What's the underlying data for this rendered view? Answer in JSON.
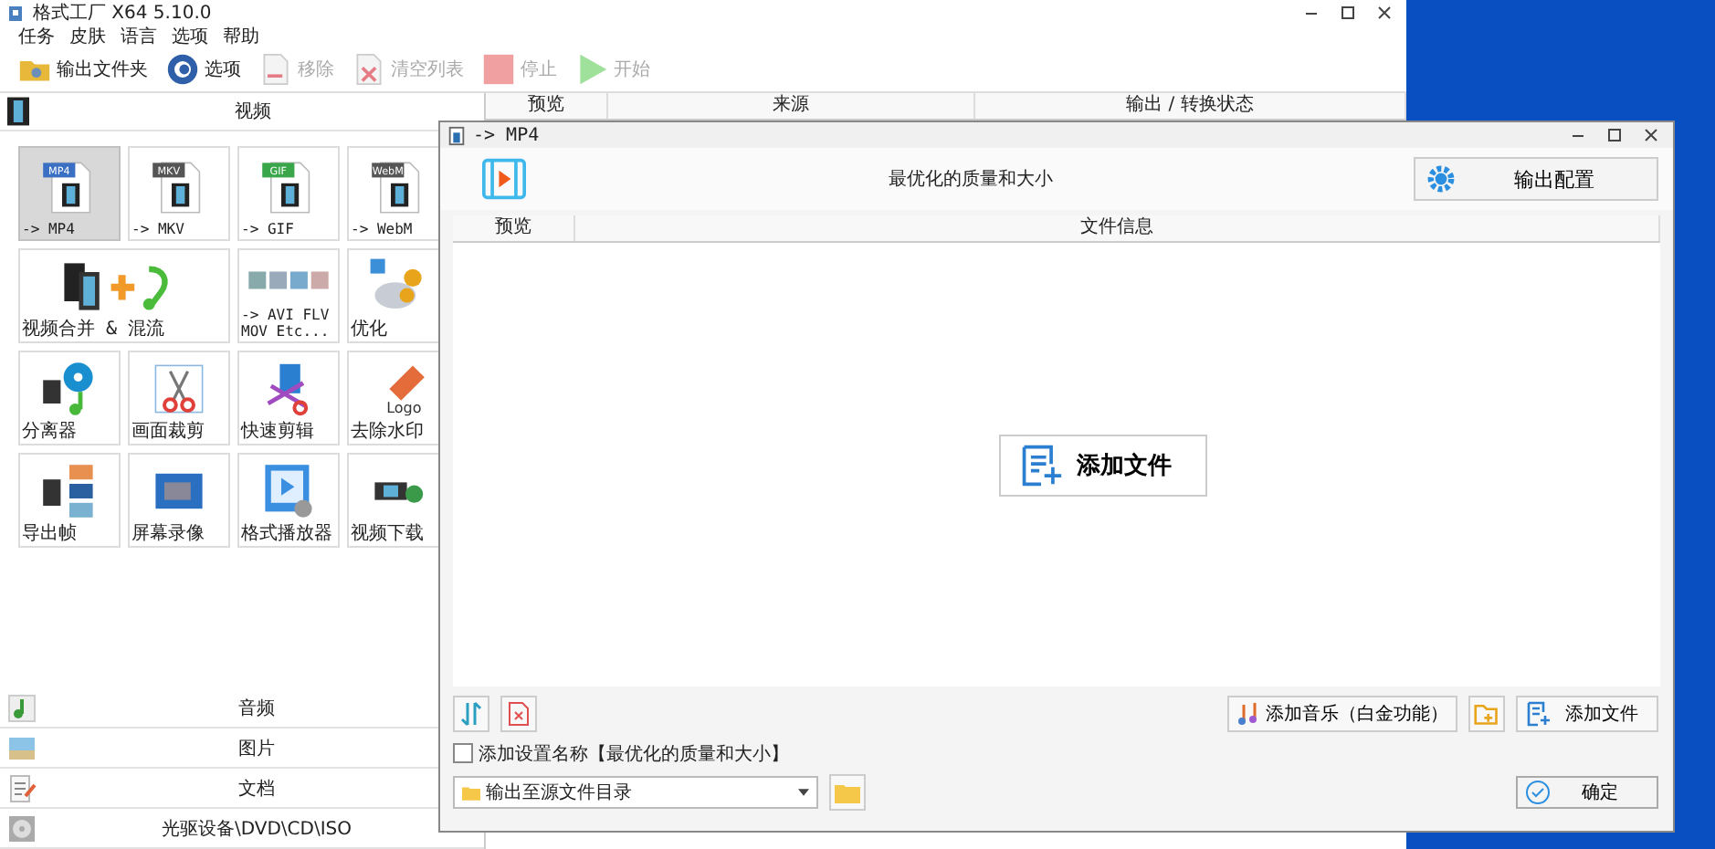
{
  "main_window": {
    "title": "格式工厂 X64 5.10.0",
    "menu": [
      "任务",
      "皮肤",
      "语言",
      "选项",
      "帮助"
    ],
    "toolbar": [
      {
        "label": "输出文件夹",
        "kind": "folder",
        "disabled": false
      },
      {
        "label": "选项",
        "kind": "options",
        "disabled": false
      },
      {
        "label": "移除",
        "kind": "remove",
        "disabled": true
      },
      {
        "label": "清空列表",
        "kind": "clear",
        "disabled": true
      },
      {
        "label": "停止",
        "kind": "stop",
        "disabled": true
      },
      {
        "label": "开始",
        "kind": "start",
        "disabled": true
      }
    ],
    "video_category": {
      "label": "视频"
    },
    "tools": [
      {
        "label": "-> MP4",
        "kind": "format",
        "badge": "MP4",
        "color": "#3a6fc4",
        "selected": true
      },
      {
        "label": "-> MKV",
        "kind": "format",
        "badge": "MKV",
        "color": "#555555",
        "selected": false
      },
      {
        "label": "-> GIF",
        "kind": "format",
        "badge": "GIF",
        "color": "#3aa64a",
        "selected": false
      },
      {
        "label": "-> WebM",
        "kind": "format",
        "badge": "WebM",
        "color": "#555555",
        "selected": false
      },
      {
        "label": "视频合并 & 混流",
        "kind": "merge",
        "selected": false
      },
      {
        "label": "-> AVI FLV MOV Etc...",
        "kind": "multi",
        "selected": false
      },
      {
        "label": "优化",
        "kind": "optimize",
        "selected": false
      },
      {
        "label": "分离器",
        "kind": "split",
        "selected": false
      },
      {
        "label": "画面裁剪",
        "kind": "crop",
        "selected": false
      },
      {
        "label": "快速剪辑",
        "kind": "cut",
        "selected": false
      },
      {
        "label": "去除水印",
        "kind": "watermark",
        "badge": "Logo",
        "selected": false
      },
      {
        "label": "导出帧",
        "kind": "frames",
        "selected": false
      },
      {
        "label": "屏幕录像",
        "kind": "record",
        "selected": false
      },
      {
        "label": "格式播放器",
        "kind": "player",
        "selected": false
      },
      {
        "label": "视频下载",
        "kind": "download",
        "selected": false
      }
    ],
    "other_categories": [
      {
        "label": "音频",
        "kind": "audio"
      },
      {
        "label": "图片",
        "kind": "image"
      },
      {
        "label": "文档",
        "kind": "document"
      },
      {
        "label": "光驱设备\\DVD\\CD\\ISO",
        "kind": "disc"
      }
    ],
    "task_columns": [
      "预览",
      "来源",
      "输出 / 转换状态"
    ]
  },
  "dialog": {
    "title": "-> MP4",
    "heading": "最优化的质量和大小",
    "config_button": "输出配置",
    "columns": [
      "预览",
      "文件信息"
    ],
    "center_add_button": "添加文件",
    "music_button": "添加音乐（白金功能）",
    "add_file_button": "添加文件",
    "name_checkbox": {
      "label": "添加设置名称【最优化的质量和大小】",
      "checked": false
    },
    "output_select": {
      "value": "输出至源文件目录"
    },
    "ok_button": "确定"
  }
}
